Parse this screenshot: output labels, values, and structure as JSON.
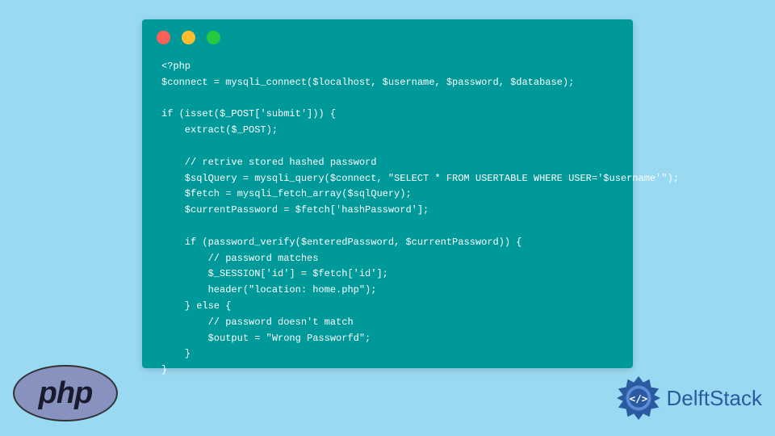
{
  "code_window": {
    "content": "<?php\n$connect = mysqli_connect($localhost, $username, $password, $database);\n\nif (isset($_POST['submit'])) {\n    extract($_POST);\n\n    // retrive stored hashed password\n    $sqlQuery = mysqli_query($connect, \"SELECT * FROM USERTABLE WHERE USER='$username'\");\n    $fetch = mysqli_fetch_array($sqlQuery);\n    $currentPassword = $fetch['hashPassword'];\n\n    if (password_verify($enteredPassword, $currentPassword)) {\n        // password matches\n        $_SESSION['id'] = $fetch['id'];\n        header(\"location: home.php\");\n    } else {\n        // password doesn't match\n        $output = \"Wrong Passworfd\";\n    }\n}"
  },
  "php_logo": {
    "text": "php"
  },
  "delftstack": {
    "text": "DelftStack"
  }
}
